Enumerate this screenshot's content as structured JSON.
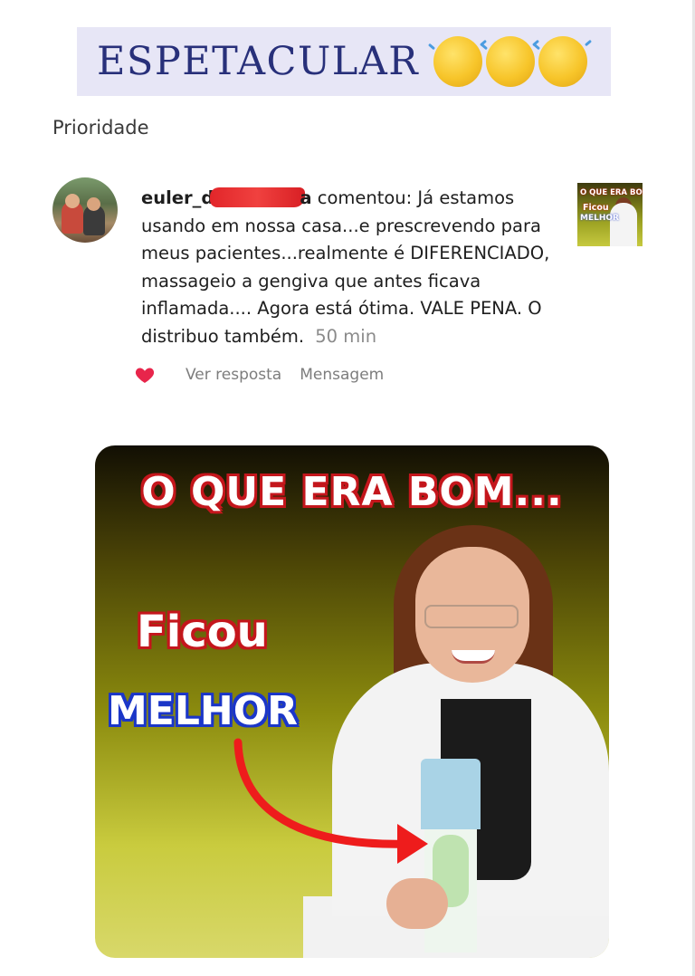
{
  "banner": {
    "text": "ESPETACULAR",
    "emoji": "clapping-hands"
  },
  "section_label": "Prioridade",
  "comment": {
    "username": "euler_d",
    "username_tail": "a",
    "body": "comentou: Já estamos usando em nossa casa...e prescrevendo para meus pacientes...realmente é DIFERENCIADO, massageio a gengiva que antes ficava inflamada.... Agora está ótima. VALE PENA. O distribuo também.",
    "time": "50 min",
    "like_color": "#e8254b"
  },
  "actions": {
    "reply": "Ver resposta",
    "message": "Mensagem"
  },
  "thumbnail": {
    "line1": "O QUE ERA BOM...",
    "line2": "Ficou",
    "line3": "MELHOR"
  },
  "video": {
    "title": "O QUE ERA BOM...",
    "line1": "Ficou",
    "line2": "MELHOR",
    "accent_red": "#c4161c",
    "accent_blue": "#1b36c8"
  }
}
